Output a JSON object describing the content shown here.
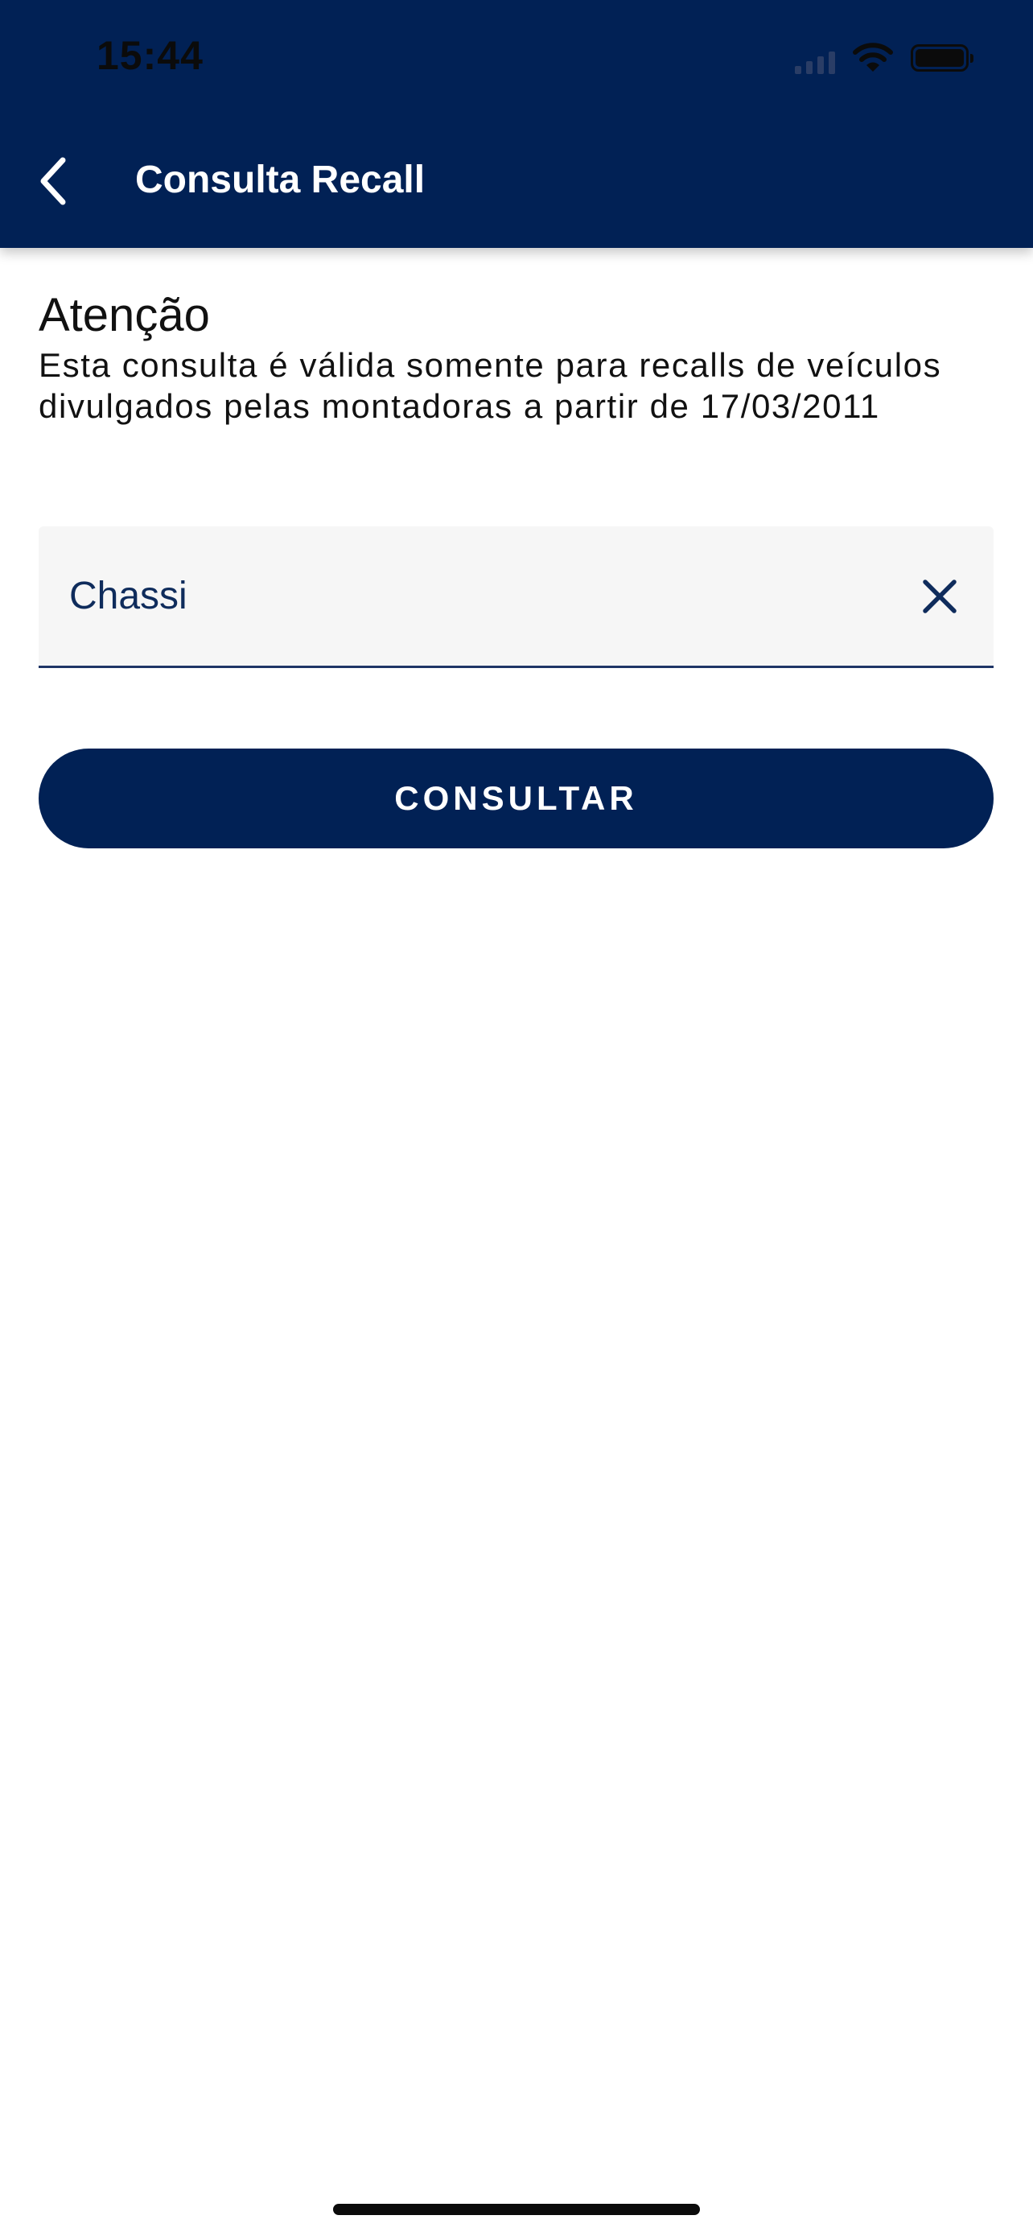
{
  "status_bar": {
    "time": "15:44",
    "icons": [
      "cellular-signal-icon",
      "wifi-icon",
      "battery-icon"
    ]
  },
  "header": {
    "back_icon": "chevron-left-icon",
    "title": "Consulta Recall"
  },
  "notice": {
    "heading": "Atenção",
    "text": "Esta consulta é válida somente para recalls de veículos divulgados pelas montadoras a partir de 17/03/2011"
  },
  "form": {
    "chassi": {
      "placeholder": "Chassi",
      "value": "",
      "clear_icon": "close-icon"
    },
    "submit_label": "CONSULTAR"
  },
  "colors": {
    "primary": "#012155",
    "field_background": "#f6f6f6",
    "text": "#111111",
    "on_primary": "#ffffff"
  }
}
